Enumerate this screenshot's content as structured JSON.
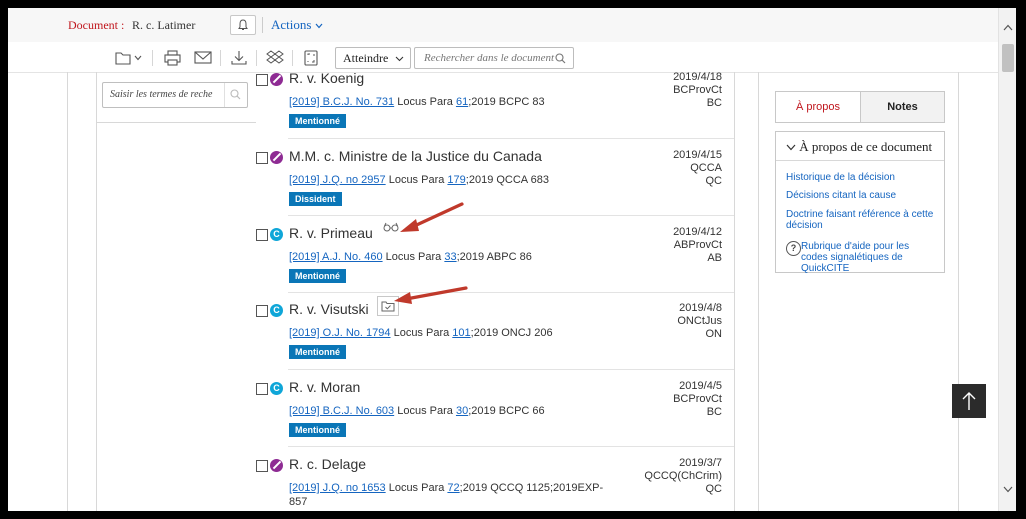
{
  "header": {
    "doc_label": "Document :",
    "doc_name": "R. c. Latimer",
    "actions_label": "Actions"
  },
  "toolbar": {
    "goto_label": "Atteindre",
    "search_placeholder": "Rechercher dans le document"
  },
  "left_search": {
    "placeholder": "Saisir les termes de reche"
  },
  "cases": [
    {
      "title": "R. v. Koenig",
      "signal": "purple",
      "cite_link": "[2019] B.C.J. No. 731",
      "locus_label": "Locus Para",
      "locus_para": "61",
      "cite_rest": ";2019 BCPC 83",
      "badge": "Mentionné",
      "date_lines": [
        "2019/4/18",
        "BCProvCt",
        "BC"
      ]
    },
    {
      "title": "M.M. c. Ministre de la Justice du Canada",
      "signal": "purple",
      "cite_link": "[2019] J.Q. no 2957",
      "locus_label": "Locus Para",
      "locus_para": "179",
      "cite_rest": ";2019 QCCA 683",
      "badge": "Dissident",
      "date_lines": [
        "2019/4/15",
        "QCCA",
        "QC"
      ]
    },
    {
      "title": "R. v. Primeau",
      "signal": "cyan",
      "signal_letter": "C",
      "cite_link": "[2019] A.J. No. 460",
      "locus_label": "Locus Para",
      "locus_para": "33",
      "cite_rest": ";2019 ABPC 86",
      "badge": "Mentionné",
      "date_lines": [
        "2019/4/12",
        "ABProvCt",
        "AB"
      ]
    },
    {
      "title": "R. v. Visutski",
      "signal": "cyan",
      "signal_letter": "C",
      "cite_link": "[2019] O.J. No. 1794",
      "locus_label": "Locus Para",
      "locus_para": "101",
      "cite_rest": ";2019 ONCJ 206",
      "badge": "Mentionné",
      "date_lines": [
        "2019/4/8",
        "ONCtJus",
        "ON"
      ]
    },
    {
      "title": "R. v. Moran",
      "signal": "cyan",
      "signal_letter": "C",
      "cite_link": "[2019] B.C.J. No. 603",
      "locus_label": "Locus Para",
      "locus_para": "30",
      "cite_rest": ";2019 BCPC 66",
      "badge": "Mentionné",
      "date_lines": [
        "2019/4/5",
        "BCProvCt",
        "BC"
      ]
    },
    {
      "title": "R. c. Delage",
      "signal": "purple",
      "cite_link": "[2019] J.Q. no 1653",
      "locus_label": "Locus Para",
      "locus_para": "72",
      "cite_rest": ";2019 QCCQ 1125;2019EXP-",
      "cite_rest_2": "857",
      "date_lines": [
        "2019/3/7",
        "QCCQ(ChCrim)",
        "QC"
      ]
    }
  ],
  "right_panel": {
    "tab_about": "À propos",
    "tab_notes": "Notes",
    "heading": "À propos de ce document",
    "links": [
      "Historique de la décision",
      "Décisions citant la cause",
      "Doctrine faisant référence à cette décision",
      "Rubrique d'aide pour les codes signalétiques de QuickCITE"
    ],
    "help_glyph": "?"
  },
  "colors": {
    "accent_red": "#c0161d",
    "link_blue": "#1565c0",
    "badge_blue": "#0a76b7",
    "signal_purple": "#8e2b93",
    "signal_cyan": "#0fa6d8",
    "annotation_arrow": "#c0392b"
  }
}
